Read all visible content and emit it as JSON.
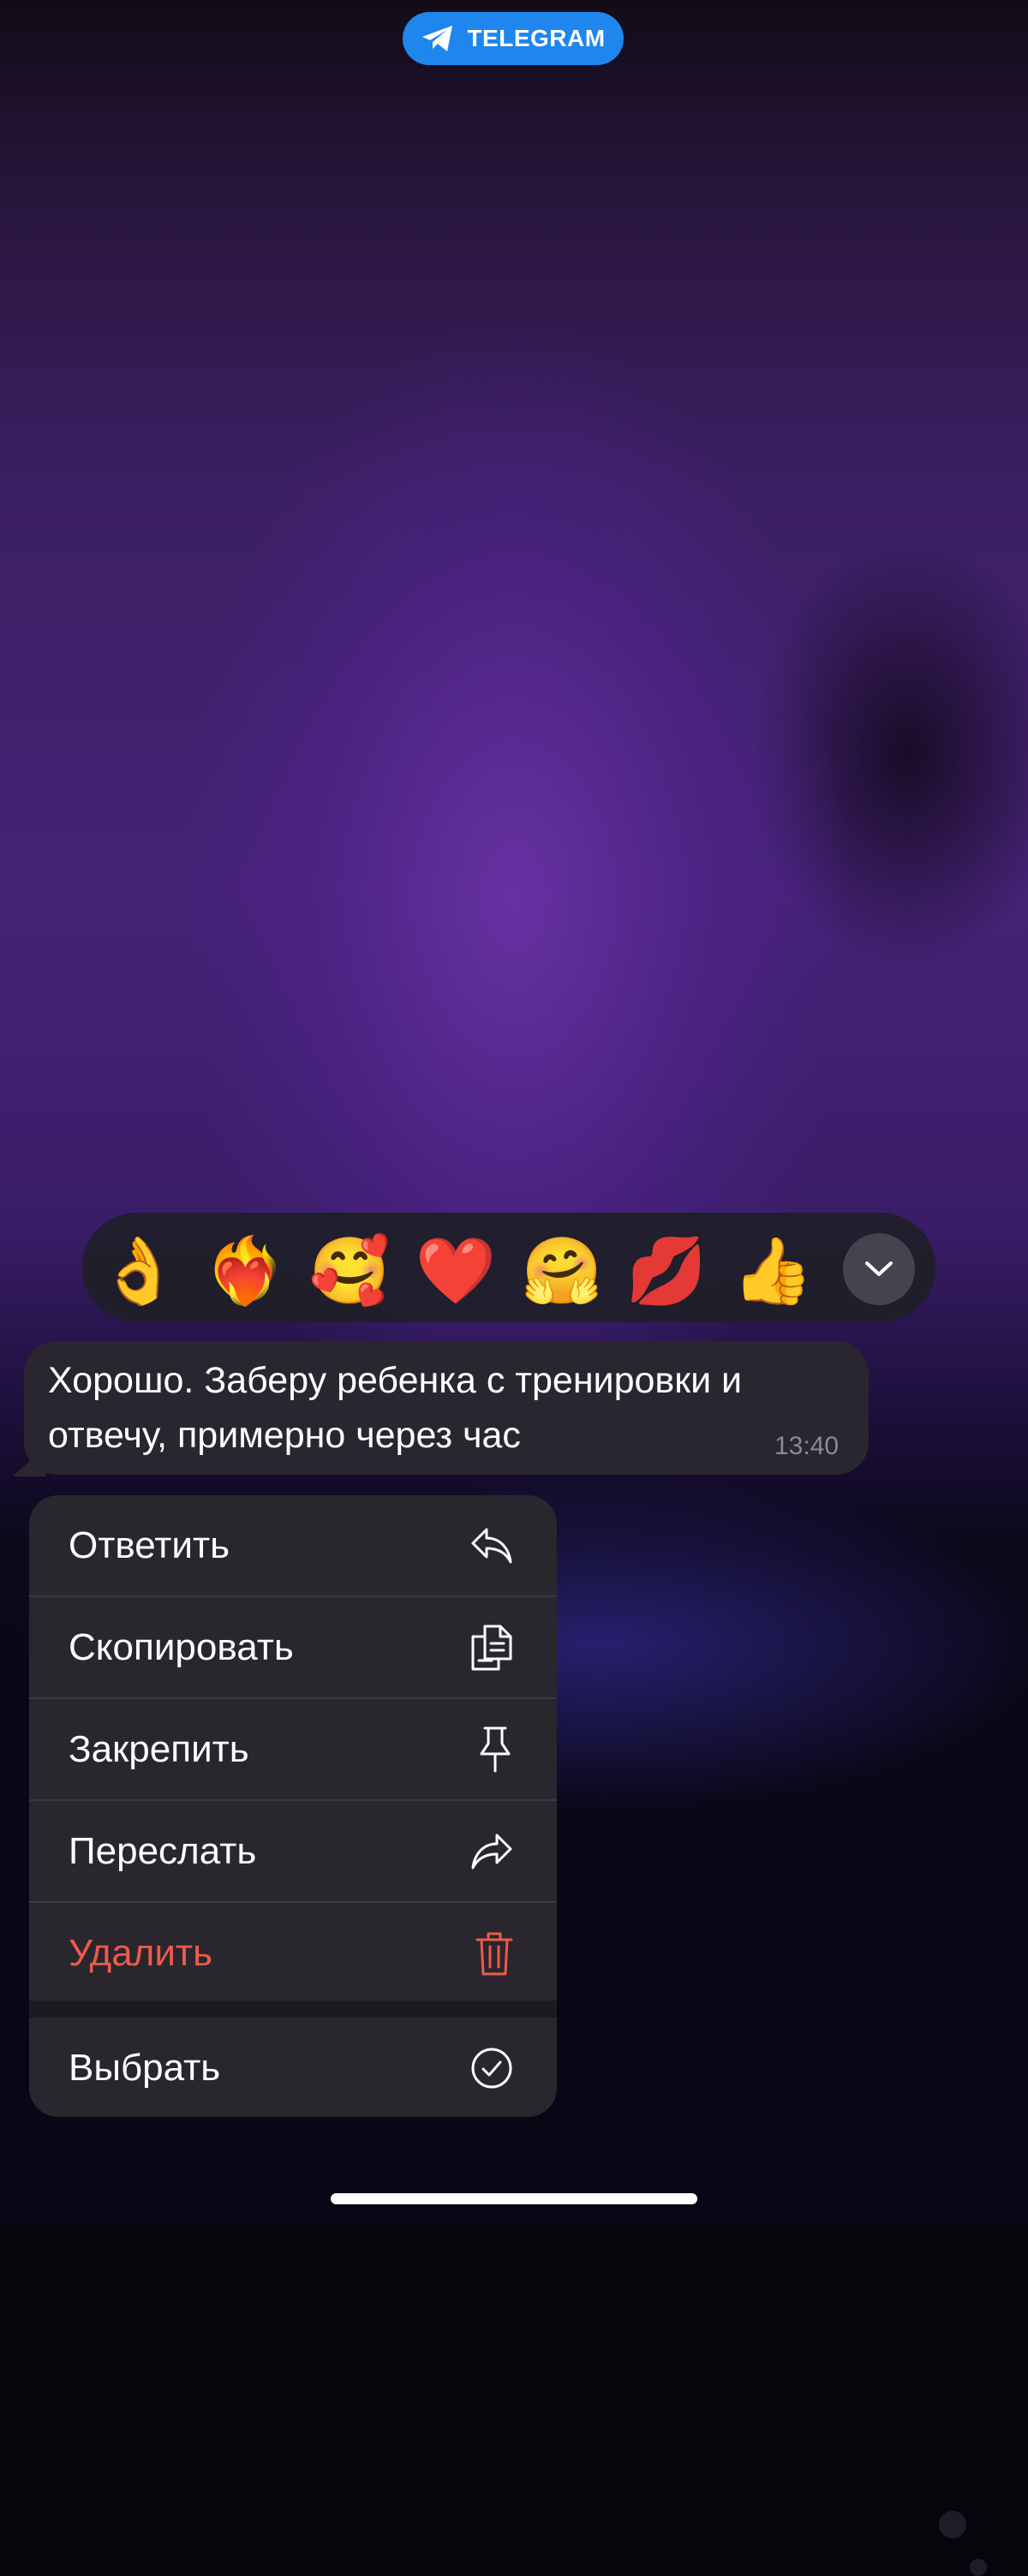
{
  "badge": {
    "label": "TELEGRAM",
    "icon": "telegram-plane-icon",
    "color": "#1f86ee"
  },
  "reactions": {
    "items": [
      {
        "name": "ok-hand",
        "emoji": "👌"
      },
      {
        "name": "heart-on-fire",
        "emoji": "❤️‍🔥"
      },
      {
        "name": "smiling-face-with-hearts",
        "emoji": "🥰"
      },
      {
        "name": "red-heart",
        "emoji": "❤️"
      },
      {
        "name": "hugging-face",
        "emoji": "🤗"
      },
      {
        "name": "kiss-mark",
        "emoji": "💋"
      },
      {
        "name": "thumbs-up",
        "emoji": "👍"
      }
    ],
    "expand_icon": "chevron-down-icon"
  },
  "message": {
    "text": "Хорошо. Заберу ребенка с тренировки и отвечу, примерно через час",
    "time": "13:40"
  },
  "menu": {
    "reply": {
      "label": "Ответить",
      "icon": "reply-icon"
    },
    "copy": {
      "label": "Скопировать",
      "icon": "copy-icon"
    },
    "pin": {
      "label": "Закрепить",
      "icon": "pin-icon"
    },
    "forward": {
      "label": "Переслать",
      "icon": "forward-icon"
    },
    "delete": {
      "label": "Удалить",
      "icon": "trash-icon",
      "color": "#ee5a4a"
    },
    "select": {
      "label": "Выбрать",
      "icon": "check-circle-icon"
    }
  }
}
